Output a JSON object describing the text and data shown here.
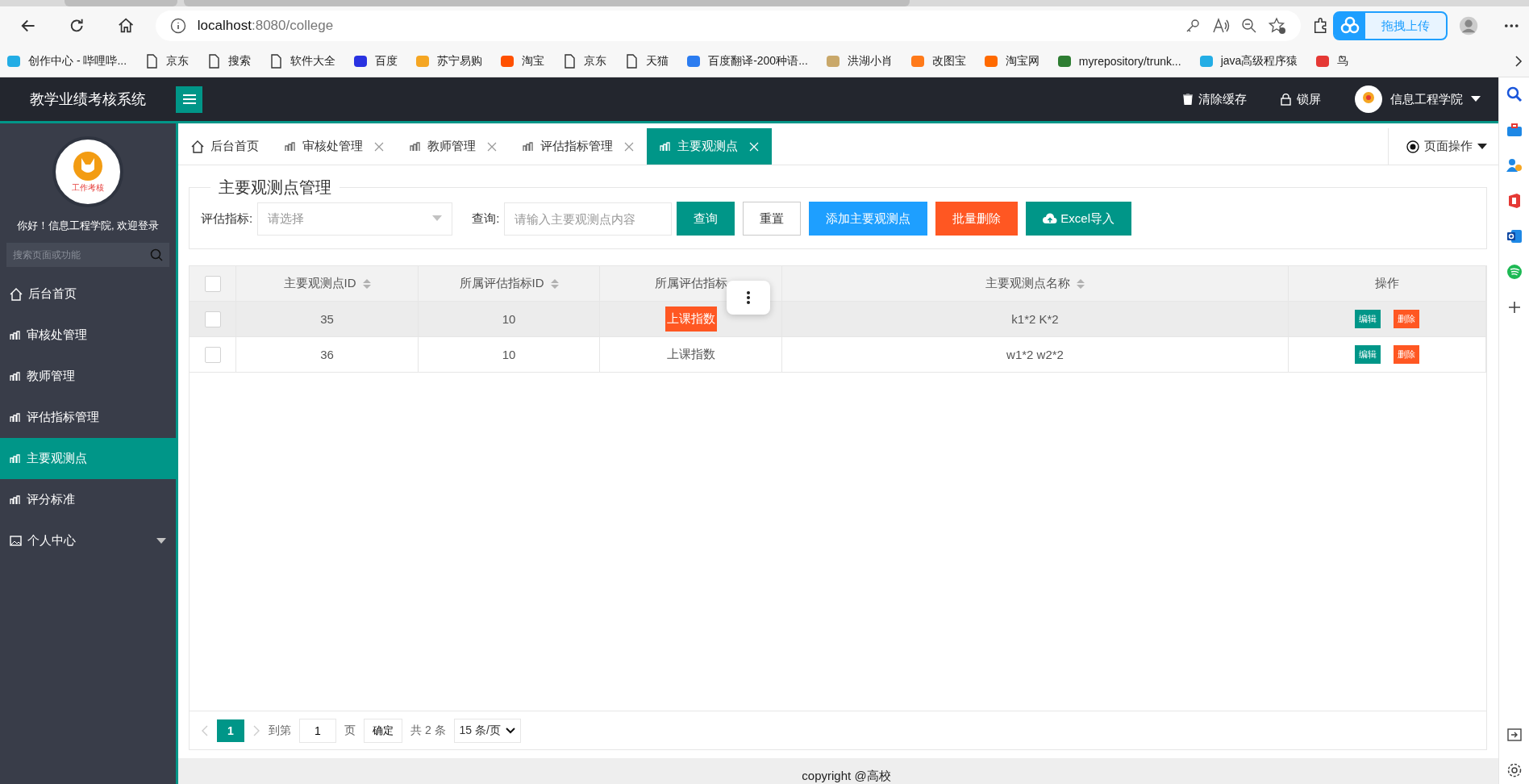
{
  "browser": {
    "address_host": "localhost",
    "address_rest": ":8080/college",
    "upload_button": "拖拽上传",
    "bookmarks": [
      {
        "label": "创作中心 - 哔哩哔...",
        "kind": "site",
        "color": "#23ade5"
      },
      {
        "label": "京东",
        "kind": "page"
      },
      {
        "label": "搜索",
        "kind": "page"
      },
      {
        "label": "软件大全",
        "kind": "page"
      },
      {
        "label": "百度",
        "kind": "site",
        "color": "#2932e1"
      },
      {
        "label": "苏宁易购",
        "kind": "site",
        "color": "#f5a623"
      },
      {
        "label": "淘宝",
        "kind": "site",
        "color": "#ff5000"
      },
      {
        "label": "京东",
        "kind": "page"
      },
      {
        "label": "天猫",
        "kind": "page"
      },
      {
        "label": "百度翻译-200种语...",
        "kind": "site",
        "color": "#2b7cf0"
      },
      {
        "label": "洪湖小肖",
        "kind": "site",
        "color": "#c9a86a"
      },
      {
        "label": "改图宝",
        "kind": "site",
        "color": "#ff7a1a"
      },
      {
        "label": "淘宝网",
        "kind": "site",
        "color": "#ff6a00"
      },
      {
        "label": "myrepository/trunk...",
        "kind": "site",
        "color": "#2e7d32"
      },
      {
        "label": "java高级程序猿",
        "kind": "site",
        "color": "#23ade5"
      },
      {
        "label": "鸟",
        "kind": "site",
        "color": "#e53935"
      }
    ]
  },
  "header": {
    "title": "教学业绩考核系统",
    "actions": [
      {
        "label": "清除缓存",
        "kind": "trash"
      },
      {
        "label": "锁屏",
        "kind": "lock"
      }
    ],
    "user": "信息工程学院"
  },
  "sidebar": {
    "logo_text": "工作考核",
    "welcome": "你好！信息工程学院, 欢迎登录",
    "search_placeholder": "搜索页面或功能",
    "items": [
      {
        "label": "后台首页",
        "kind": "home",
        "selected": false
      },
      {
        "label": "审核处管理",
        "kind": "page",
        "selected": false
      },
      {
        "label": "教师管理",
        "kind": "page",
        "selected": false
      },
      {
        "label": "评估指标管理",
        "kind": "page",
        "selected": false
      },
      {
        "label": "主要观测点",
        "kind": "page",
        "selected": true
      },
      {
        "label": "评分标准",
        "kind": "page",
        "selected": false
      },
      {
        "label": "个人中心",
        "kind": "group",
        "selected": false,
        "expanded": false
      }
    ]
  },
  "tabs": [
    {
      "label": "后台首页",
      "kind": "home",
      "selected": false
    },
    {
      "label": "审核处管理",
      "kind": "page",
      "selected": false
    },
    {
      "label": "教师管理",
      "kind": "page",
      "selected": false
    },
    {
      "label": "评估指标管理",
      "kind": "page",
      "selected": false
    },
    {
      "label": "主要观测点",
      "kind": "page",
      "selected": true
    }
  ],
  "page_ops": "页面操作",
  "panel": {
    "legend": "主要观测点管理",
    "select_label": "评估指标:",
    "select_placeholder": "请选择",
    "query_label": "查询:",
    "query_placeholder": "请输入主要观测点内容",
    "buttons": [
      {
        "label": "查询",
        "kind": "primary"
      },
      {
        "label": "重置",
        "kind": "plain"
      },
      {
        "label": "添加主要观测点",
        "kind": "info"
      },
      {
        "label": "批量删除",
        "kind": "danger"
      },
      {
        "label": "Excel导入",
        "kind": "upload"
      }
    ]
  },
  "table": {
    "select_all_checked": false,
    "columns": [
      {
        "label": "主要观测点ID",
        "sortable": true
      },
      {
        "label": "所属评估指标ID",
        "sortable": true
      },
      {
        "label": "所属评估指标",
        "sortable": false
      },
      {
        "label": "主要观测点名称",
        "sortable": true
      },
      {
        "label": "操作",
        "sortable": false
      }
    ],
    "rows": [
      {
        "checked": false,
        "hovered": true,
        "id": "35",
        "indicator_id": "10",
        "indicator": "上课指数",
        "indicator_marked": true,
        "name": "k1*2 K*2",
        "actions": [
          {
            "label": "编辑",
            "kind": "edit"
          },
          {
            "label": "删除",
            "kind": "delete"
          }
        ]
      },
      {
        "checked": false,
        "hovered": false,
        "id": "36",
        "indicator_id": "10",
        "indicator": "上课指数",
        "indicator_marked": false,
        "name": "w1*2 w2*2",
        "actions": [
          {
            "label": "编辑",
            "kind": "edit"
          },
          {
            "label": "删除",
            "kind": "delete"
          }
        ]
      }
    ]
  },
  "pagination": {
    "pages": [
      {
        "label": "1",
        "selected": true
      }
    ],
    "goto_label": "到第",
    "goto_value": "1",
    "page_unit": "页",
    "confirm": "确定",
    "total": "共 2 条",
    "page_size": "15 条/页"
  },
  "footer": "copyright @高校"
}
